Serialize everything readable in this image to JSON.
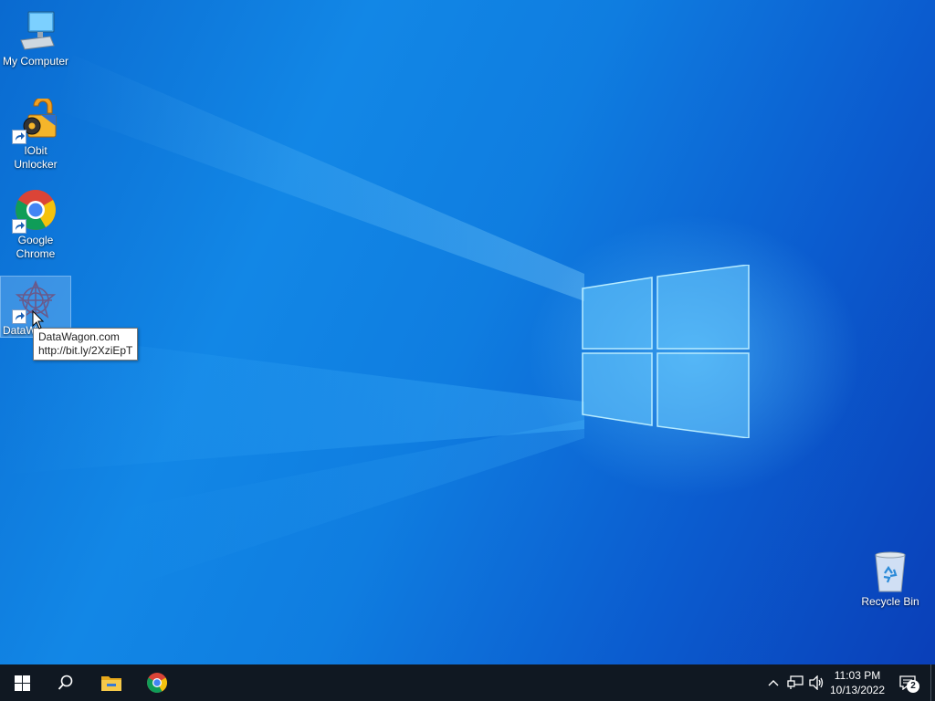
{
  "desktop": {
    "icons": [
      {
        "label": "My Computer",
        "icon": "computer-icon"
      },
      {
        "label": "IObit Unlocker",
        "icon": "iobit-unlocker-icon",
        "shortcut": true
      },
      {
        "label": "Google Chrome",
        "icon": "chrome-icon",
        "shortcut": true
      },
      {
        "label": "DataWagon.com",
        "visible_label": "DataW",
        "icon": "datawagon-icon",
        "shortcut": true,
        "selected": true
      },
      {
        "label": "Recycle Bin",
        "icon": "recycle-bin-icon"
      }
    ],
    "tooltip": {
      "line1": "DataWagon.com",
      "line2": "http://bit.ly/2XziEpT"
    }
  },
  "taskbar": {
    "pinned": [
      {
        "name": "start",
        "icon": "windows-icon"
      },
      {
        "name": "search",
        "icon": "search-icon"
      },
      {
        "name": "file-explorer",
        "icon": "folder-icon"
      },
      {
        "name": "chrome",
        "icon": "chrome-icon"
      }
    ],
    "tray": {
      "icons": [
        "chevron-up-icon",
        "network-icon",
        "speaker-icon"
      ],
      "time": "11:03 PM",
      "date": "10/13/2022",
      "notification_count": "2"
    }
  },
  "colors": {
    "taskbar": "#101822",
    "wallpaper": "#0f7de0",
    "accent": "#43b6ff"
  }
}
